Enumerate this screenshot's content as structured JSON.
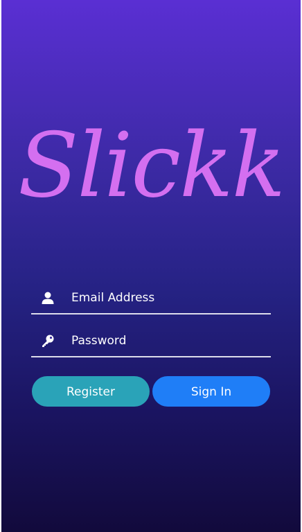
{
  "app": {
    "logo_text": "Slickk"
  },
  "login": {
    "email": {
      "placeholder": "Email Address",
      "value": "",
      "icon": "user-icon"
    },
    "password": {
      "placeholder": "Password",
      "value": "",
      "icon": "key-icon"
    }
  },
  "actions": {
    "register_label": "Register",
    "signin_label": "Sign In"
  },
  "colors": {
    "logo": "#d46ff0",
    "register_button": "#2aa3b8",
    "signin_button": "#1f7ef7",
    "background_top": "#5a2fd3",
    "background_bottom": "#120a3c"
  }
}
